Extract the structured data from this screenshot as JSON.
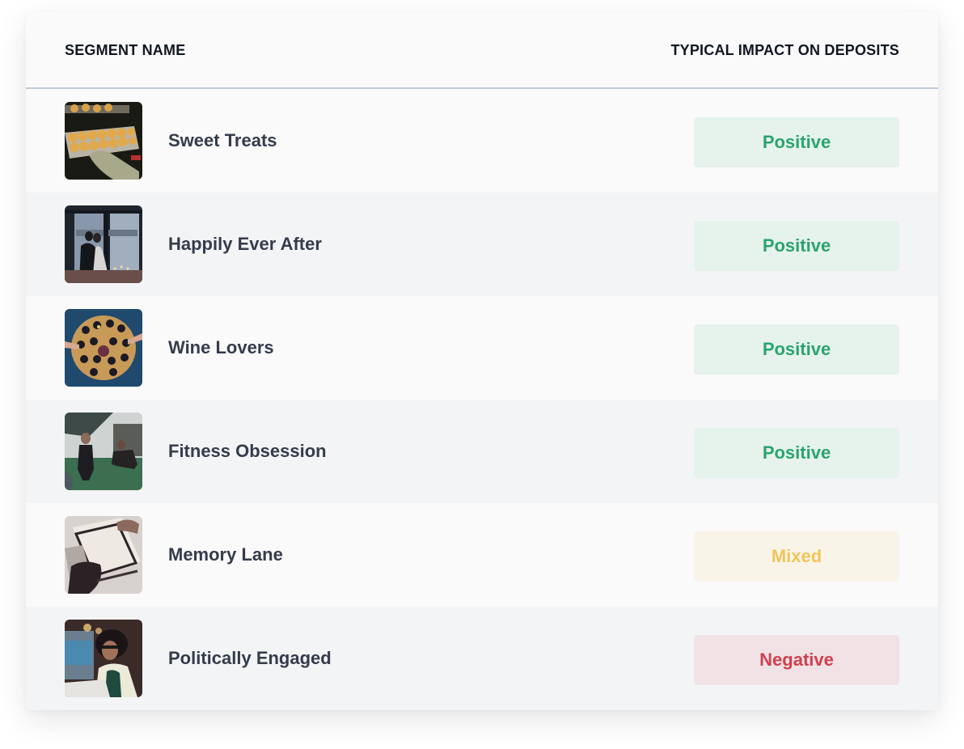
{
  "table": {
    "columns": {
      "segment": "SEGMENT NAME",
      "impact": "TYPICAL IMPACT ON DEPOSITS"
    },
    "rows": [
      {
        "name": "Sweet Treats",
        "image": "muffins-oven-photo",
        "impact": "Positive"
      },
      {
        "name": "Happily Ever After",
        "image": "wedding-couple-photo",
        "impact": "Positive"
      },
      {
        "name": "Wine Lovers",
        "image": "wine-bottles-table-photo",
        "impact": "Positive"
      },
      {
        "name": "Fitness Obsession",
        "image": "gym-workout-photo",
        "impact": "Positive"
      },
      {
        "name": "Memory Lane",
        "image": "photo-albums-photo",
        "impact": "Mixed"
      },
      {
        "name": "Politically Engaged",
        "image": "woman-reading-newspaper-photo",
        "impact": "Negative"
      }
    ]
  },
  "impact_colors": {
    "Positive": {
      "text": "#2aa46e",
      "bg": "#e6f2ec"
    },
    "Mixed": {
      "text": "#f0c55a",
      "bg": "#f9f4e8"
    },
    "Negative": {
      "text": "#d23f4e",
      "bg": "#f0e2e5"
    }
  }
}
